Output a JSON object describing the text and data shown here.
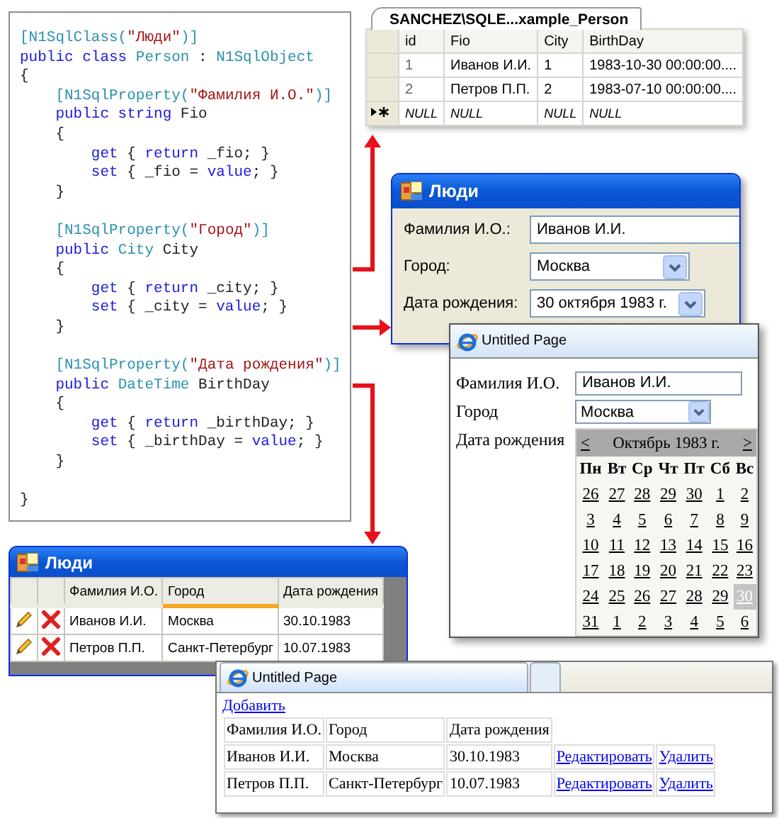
{
  "code_panel": {
    "blocks": [
      [
        [
          {
            "kind": "type",
            "text": "[N1SqlClass("
          },
          {
            "kind": "string",
            "text": "\"Люди\""
          },
          {
            "kind": "type",
            "text": ")]"
          }
        ],
        [
          {
            "kind": "keyword",
            "text": "public class "
          },
          {
            "kind": "type",
            "text": "Person"
          },
          {
            "kind": "plain",
            "text": " : "
          },
          {
            "kind": "type",
            "text": "N1SqlObject"
          }
        ],
        [
          {
            "kind": "plain",
            "text": "{"
          }
        ],
        [
          {
            "kind": "type",
            "text": "    [N1SqlProperty("
          },
          {
            "kind": "string",
            "text": "\"Фамилия И.О.\""
          },
          {
            "kind": "type",
            "text": ")]"
          }
        ],
        [
          {
            "kind": "keyword",
            "text": "    public string"
          },
          {
            "kind": "plain",
            "text": " Fio"
          }
        ],
        [
          {
            "kind": "plain",
            "text": "    {"
          }
        ],
        [
          {
            "kind": "keyword",
            "text": "        get"
          },
          {
            "kind": "plain",
            "text": " { "
          },
          {
            "kind": "keyword",
            "text": "return"
          },
          {
            "kind": "plain",
            "text": " _fio; }"
          }
        ],
        [
          {
            "kind": "keyword",
            "text": "        set"
          },
          {
            "kind": "plain",
            "text": " { _fio = "
          },
          {
            "kind": "keyword",
            "text": "value"
          },
          {
            "kind": "plain",
            "text": "; }"
          }
        ],
        [
          {
            "kind": "plain",
            "text": "    }"
          }
        ]
      ],
      [
        [
          {
            "kind": "type",
            "text": "    [N1SqlProperty("
          },
          {
            "kind": "string",
            "text": "\"Город\""
          },
          {
            "kind": "type",
            "text": ")]"
          }
        ],
        [
          {
            "kind": "keyword",
            "text": "    public "
          },
          {
            "kind": "type",
            "text": "City"
          },
          {
            "kind": "plain",
            "text": " City"
          }
        ],
        [
          {
            "kind": "plain",
            "text": "    {"
          }
        ],
        [
          {
            "kind": "keyword",
            "text": "        get"
          },
          {
            "kind": "plain",
            "text": " { "
          },
          {
            "kind": "keyword",
            "text": "return"
          },
          {
            "kind": "plain",
            "text": " _city; }"
          }
        ],
        [
          {
            "kind": "keyword",
            "text": "        set"
          },
          {
            "kind": "plain",
            "text": " { _city = "
          },
          {
            "kind": "keyword",
            "text": "value"
          },
          {
            "kind": "plain",
            "text": "; }"
          }
        ],
        [
          {
            "kind": "plain",
            "text": "    }"
          }
        ]
      ],
      [
        [
          {
            "kind": "type",
            "text": "    [N1SqlProperty("
          },
          {
            "kind": "string",
            "text": "\"Дата рождения\""
          },
          {
            "kind": "type",
            "text": ")]"
          }
        ],
        [
          {
            "kind": "keyword",
            "text": "    public "
          },
          {
            "kind": "type",
            "text": "DateTime"
          },
          {
            "kind": "plain",
            "text": " BirthDay"
          }
        ],
        [
          {
            "kind": "plain",
            "text": "    {"
          }
        ],
        [
          {
            "kind": "keyword",
            "text": "        get"
          },
          {
            "kind": "plain",
            "text": " { "
          },
          {
            "kind": "keyword",
            "text": "return"
          },
          {
            "kind": "plain",
            "text": " _birthDay; }"
          }
        ],
        [
          {
            "kind": "keyword",
            "text": "        set"
          },
          {
            "kind": "plain",
            "text": " { _birthDay = "
          },
          {
            "kind": "keyword",
            "text": "value"
          },
          {
            "kind": "plain",
            "text": "; }"
          }
        ],
        [
          {
            "kind": "plain",
            "text": "    }"
          }
        ]
      ],
      [
        [
          {
            "kind": "plain",
            "text": "}"
          }
        ]
      ]
    ]
  },
  "sql_table": {
    "tab": "SANCHEZ\\SQLE...xample_Person",
    "columns": [
      "id",
      "Fio",
      "City",
      "BirthDay"
    ],
    "rows": [
      {
        "kind": "data",
        "cells": [
          "1",
          "Иванов И.И.",
          "1",
          "1983-10-30 00:00:00...."
        ]
      },
      {
        "kind": "data",
        "cells": [
          "2",
          "Петров П.П.",
          "2",
          "1983-07-10 00:00:00...."
        ]
      },
      {
        "kind": "new",
        "cells": [
          "NULL",
          "NULL",
          "NULL",
          "NULL"
        ]
      }
    ]
  },
  "form_window": {
    "title": "Люди",
    "fields": [
      {
        "kind": "text",
        "label": "Фамилия И.О.:",
        "value": "Иванов И.И."
      },
      {
        "kind": "dropdown",
        "label": "Город:",
        "value": "Москва"
      },
      {
        "kind": "dropdown",
        "label": "Дата рождения:",
        "value": "30 октября 1983 г."
      }
    ]
  },
  "web_form_window": {
    "title": "Untitled Page",
    "fields": [
      {
        "kind": "text",
        "label": "Фамилия И.О.",
        "value": "Иванов И.И."
      },
      {
        "kind": "dropdown",
        "label": "Город",
        "value": "Москва"
      },
      {
        "kind": "calendar",
        "label": "Дата рождения",
        "calendar": {
          "prev": "<",
          "title": "Октябрь 1983 г.",
          "next": ">",
          "weekdays": [
            "Пн",
            "Вт",
            "Ср",
            "Чт",
            "Пт",
            "Сб",
            "Вс"
          ],
          "weeks": [
            [
              {
                "day": "26",
                "selected": false
              },
              {
                "day": "27",
                "selected": false
              },
              {
                "day": "28",
                "selected": false
              },
              {
                "day": "29",
                "selected": false
              },
              {
                "day": "30",
                "selected": false
              },
              {
                "day": "1",
                "selected": false
              },
              {
                "day": "2",
                "selected": false
              }
            ],
            [
              {
                "day": "3",
                "selected": false
              },
              {
                "day": "4",
                "selected": false
              },
              {
                "day": "5",
                "selected": false
              },
              {
                "day": "6",
                "selected": false
              },
              {
                "day": "7",
                "selected": false
              },
              {
                "day": "8",
                "selected": false
              },
              {
                "day": "9",
                "selected": false
              }
            ],
            [
              {
                "day": "10",
                "selected": false
              },
              {
                "day": "11",
                "selected": false
              },
              {
                "day": "12",
                "selected": false
              },
              {
                "day": "13",
                "selected": false
              },
              {
                "day": "14",
                "selected": false
              },
              {
                "day": "15",
                "selected": false
              },
              {
                "day": "16",
                "selected": false
              }
            ],
            [
              {
                "day": "17",
                "selected": false
              },
              {
                "day": "18",
                "selected": false
              },
              {
                "day": "19",
                "selected": false
              },
              {
                "day": "20",
                "selected": false
              },
              {
                "day": "21",
                "selected": false
              },
              {
                "day": "22",
                "selected": false
              },
              {
                "day": "23",
                "selected": false
              }
            ],
            [
              {
                "day": "24",
                "selected": false
              },
              {
                "day": "25",
                "selected": false
              },
              {
                "day": "26",
                "selected": false
              },
              {
                "day": "27",
                "selected": false
              },
              {
                "day": "28",
                "selected": false
              },
              {
                "day": "29",
                "selected": false
              },
              {
                "day": "30",
                "selected": true
              }
            ],
            [
              {
                "day": "31",
                "selected": false
              },
              {
                "day": "1",
                "selected": false
              },
              {
                "day": "2",
                "selected": false
              },
              {
                "day": "3",
                "selected": false
              },
              {
                "day": "4",
                "selected": false
              },
              {
                "day": "5",
                "selected": false
              },
              {
                "day": "6",
                "selected": false
              }
            ]
          ]
        }
      }
    ]
  },
  "grid_window": {
    "title": "Люди",
    "columns": [
      {
        "label": "Фамилия И.О.",
        "highlighted": false
      },
      {
        "label": "Город",
        "highlighted": true
      },
      {
        "label": "Дата рождения",
        "highlighted": false
      }
    ],
    "rows": [
      [
        "Иванов И.И.",
        "Москва",
        "30.10.1983"
      ],
      [
        "Петров П.П.",
        "Санкт-Петербург",
        "10.07.1983"
      ]
    ]
  },
  "web_table_window": {
    "tabs": [
      {
        "label": "Untitled Page",
        "selected": true
      },
      {
        "selected": false
      }
    ],
    "add_link": "Добавить",
    "columns": [
      "Фамилия И.О.",
      "Город",
      "Дата рождения"
    ],
    "rows": [
      {
        "cells": [
          "Иванов И.И.",
          "Москва",
          "30.10.1983"
        ],
        "actions": [
          "Редактировать",
          "Удалить"
        ]
      },
      {
        "cells": [
          "Петров П.П.",
          "Санкт-Петербург",
          "10.07.1983"
        ],
        "actions": [
          "Редактировать",
          "Удалить"
        ]
      }
    ]
  }
}
